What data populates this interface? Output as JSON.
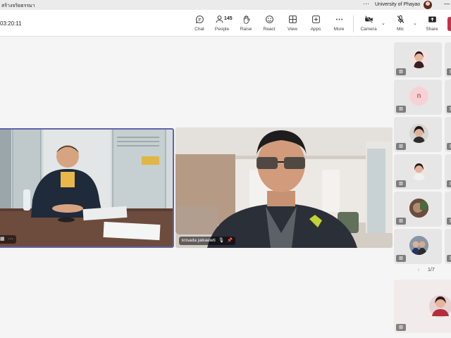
{
  "titlebar": {
    "meeting_title": "สร้างจริยธรรมา",
    "more_label": "···",
    "organization": "University of Phayao",
    "minimize_label": "—"
  },
  "toolbar": {
    "timer": "03:20:11",
    "items": [
      {
        "label": "Chat",
        "icon": "chat-icon"
      },
      {
        "label": "People",
        "icon": "people-icon",
        "count": "145"
      },
      {
        "label": "Raise",
        "icon": "hand-icon"
      },
      {
        "label": "React",
        "icon": "smiley-icon"
      },
      {
        "label": "View",
        "icon": "grid-icon"
      },
      {
        "label": "Apps",
        "icon": "plus-icon"
      },
      {
        "label": "More",
        "icon": "ellipsis-icon"
      },
      {
        "label": "Camera",
        "icon": "camera-off-icon"
      },
      {
        "label": "Mic",
        "icon": "mic-off-icon"
      },
      {
        "label": "Share",
        "icon": "share-icon"
      }
    ],
    "leave_color": "#c4314b"
  },
  "stage": {
    "right_tile": {
      "participant_name": "krisada jaikaewti"
    },
    "left_tile": {
      "controls": "···"
    }
  },
  "gallery": {
    "pager": "1/7",
    "initial_tile": "n"
  },
  "colors": {
    "accent": "#6264a7",
    "background": "#f5f5f5"
  }
}
